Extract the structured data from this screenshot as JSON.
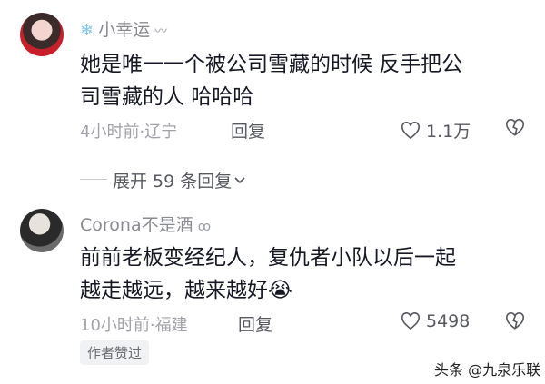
{
  "comments": [
    {
      "username": "小幸运",
      "username_prefix_icon": "snowflake-icon",
      "username_suffix": "〰",
      "text_line1": "她是唯一一个被公司雪藏的时候 反手把公",
      "text_line2": "司雪藏的人 哈哈哈",
      "meta": "4小时前·辽宁",
      "reply_label": "回复",
      "likes": "1.1万"
    },
    {
      "username": "Corona不是酒",
      "username_suffix": "ꝏ",
      "text_line1": "前前老板变经纪人，复仇者小队以后一起",
      "text_line2": "越走越远，越来越好",
      "emoji": "😭",
      "meta": "10小时前·福建",
      "reply_label": "回复",
      "likes": "5498",
      "author_tag": "作者赞过"
    }
  ],
  "expand_replies": "展开 59 条回复",
  "watermark": "头条 @九泉乐联"
}
